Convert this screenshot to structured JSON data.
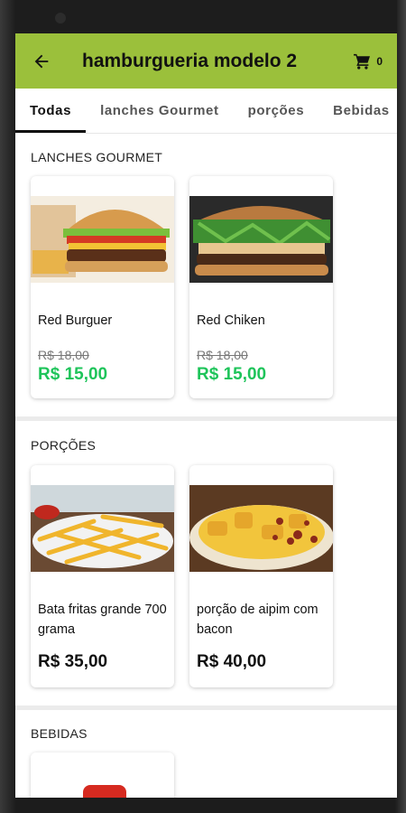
{
  "app": {
    "title": "hamburgueria modelo 2",
    "cart_count": "0"
  },
  "tabs": [
    {
      "label": "Todas",
      "active": true
    },
    {
      "label": "lanches Gourmet",
      "active": false
    },
    {
      "label": "porções",
      "active": false
    },
    {
      "label": "Bebidas",
      "active": false
    }
  ],
  "sections": [
    {
      "title": "LANCHES GOURMET",
      "items": [
        {
          "name": "Red Burguer",
          "old_price": "R$ 18,00",
          "price": "R$ 15,00",
          "image": "burger-photo"
        },
        {
          "name": "Red Chiken",
          "old_price": "R$ 18,00",
          "price": "R$ 15,00",
          "image": "chicken-burger-photo"
        }
      ]
    },
    {
      "title": "PORÇÕES",
      "items": [
        {
          "name": "Bata fritas grande 700 grama",
          "price": "R$ 35,00",
          "image": "fries-photo"
        },
        {
          "name": "porção de aipim com bacon",
          "price": "R$ 40,00",
          "image": "aipim-bacon-photo"
        }
      ]
    },
    {
      "title": "BEBIDAS",
      "items": [
        {
          "image": "soda-can-photo"
        }
      ]
    }
  ],
  "colors": {
    "appbar": "#9bc03b",
    "promo_price": "#1ec45a"
  },
  "icons": {
    "back": "arrow-left-icon",
    "cart": "shopping-cart-icon"
  }
}
